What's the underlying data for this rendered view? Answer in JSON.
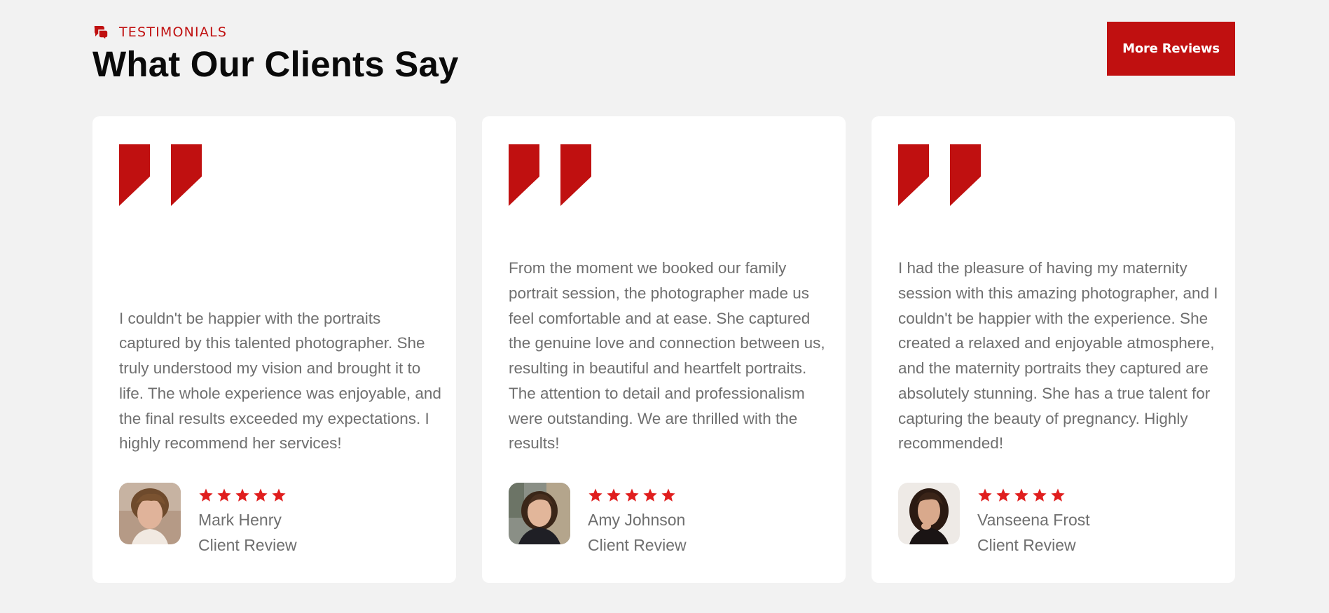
{
  "header": {
    "eyebrow_label": "TESTIMONIALS",
    "eyebrow_icon": "chat-bubbles-icon",
    "title": "What Our Clients Say",
    "more_button_label": "More Reviews"
  },
  "colors": {
    "accent": "#c01010",
    "star": "#e01e1e",
    "background": "#f2f2f2",
    "card": "#ffffff",
    "body_text": "#6f6f6f"
  },
  "testimonials": [
    {
      "text": "I couldn't be happier with the portraits captured by this talented photographer. She truly understood my vision and brought it to life. The whole experience was enjoyable, and the final results exceeded my expectations. I highly recommend her services!",
      "name": "Mark Henry",
      "role": "Client Review",
      "rating": 5,
      "avatar_icon": "avatar-photo"
    },
    {
      "text": "From the moment we booked our family portrait session, the photographer made us feel comfortable and at ease. She captured the genuine love and connection between us, resulting in beautiful and heartfelt portraits. The attention to detail and professionalism were outstanding. We are thrilled with the results!",
      "name": "Amy Johnson",
      "role": "Client Review",
      "rating": 5,
      "avatar_icon": "avatar-photo"
    },
    {
      "text": "I had the pleasure of having my maternity session with this amazing photographer, and I couldn't be happier with the experience. She created a relaxed and enjoyable atmosphere, and the maternity portraits they captured are absolutely stunning. She has a true talent for capturing the beauty of pregnancy. Highly recommended!",
      "name": "Vanseena Frost",
      "role": "Client Review",
      "rating": 5,
      "avatar_icon": "avatar-photo"
    }
  ]
}
